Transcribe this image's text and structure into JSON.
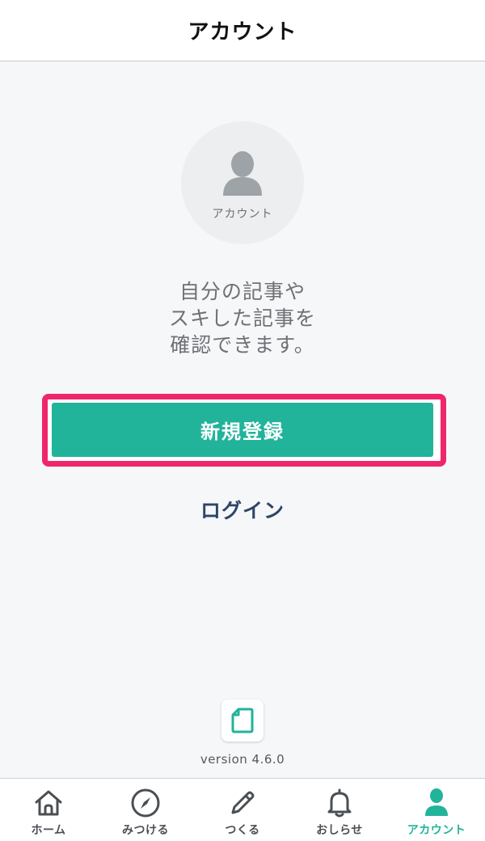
{
  "header": {
    "title": "アカウント"
  },
  "avatar": {
    "label": "アカウント",
    "icon": "person-icon"
  },
  "message": {
    "lines": [
      "自分の記事や",
      "スキした記事を",
      "確認できます。"
    ]
  },
  "signup": {
    "label": "新規登録"
  },
  "login": {
    "label": "ログイン"
  },
  "footer": {
    "version": "version 4.6.0",
    "logo_icon": "note-logo-icon"
  },
  "tabs": [
    {
      "label": "ホーム",
      "icon": "home-icon",
      "active": false
    },
    {
      "label": "みつける",
      "icon": "compass-icon",
      "active": false
    },
    {
      "label": "つくる",
      "icon": "pencil-icon",
      "active": false
    },
    {
      "label": "おしらせ",
      "icon": "bell-icon",
      "active": false
    },
    {
      "label": "アカウント",
      "icon": "person-icon",
      "active": true
    }
  ],
  "colors": {
    "accent": "#22b39b",
    "highlight": "#f0266a",
    "login_text": "#2f4568",
    "background": "#f6f7f9"
  }
}
